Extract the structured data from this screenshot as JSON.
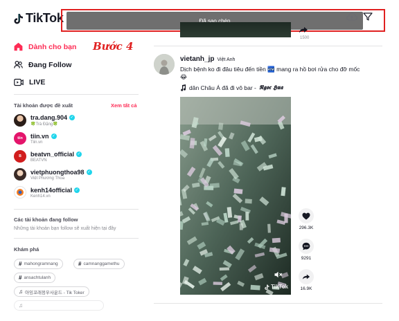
{
  "header": {
    "logo_text": "TikTok",
    "toast": "Đã sao chép"
  },
  "sidebar": {
    "nav": [
      {
        "label": "Dành cho bạn",
        "icon": "home-icon",
        "active": true
      },
      {
        "label": "Đang Follow",
        "icon": "following-icon",
        "active": false
      },
      {
        "label": "LIVE",
        "icon": "live-icon",
        "active": false
      }
    ],
    "step_label": "Bước 4",
    "suggested_title": "Tài khoản được đề xuất",
    "see_all": "Xem tất cả",
    "accounts": [
      {
        "name": "tra.dang.904",
        "sub": "🍀Trà Đặng🍀"
      },
      {
        "name": "tiin.vn",
        "sub": "Tiin.vn"
      },
      {
        "name": "beatvn_official",
        "sub": "BEATVN"
      },
      {
        "name": "vietphuongthoa98",
        "sub": "Việt Phương Thoa"
      },
      {
        "name": "kenh14official",
        "sub": "Kenh14.vn"
      }
    ],
    "following_title": "Các tài khoản đang follow",
    "following_empty": "Những tài khoản bạn follow sẽ xuất hiện tại đây",
    "discover_title": "Khám phá",
    "chips": [
      {
        "icon": "hashtag-icon",
        "label": "mahongramnang"
      },
      {
        "icon": "hashtag-icon",
        "label": "camnanggamethu"
      },
      {
        "icon": "hashtag-icon",
        "label": "ansachtulanh"
      },
      {
        "icon": "music-note-icon",
        "label": "아잉꼬래정우사운드 - Tik Toker"
      }
    ]
  },
  "feed": {
    "prev_count": "1500",
    "post": {
      "username": "vietanh_jp",
      "nickname": "Việt Anh",
      "caption": "Dịch bệnh ko đi đâu tiêu đến tiền 🏧 mang ra hồ bơi rửa cho đỡ mốc 😂",
      "music_prefix": "dân Châu Á đã đi vô bar - ",
      "music_artist": "𝕹𝖌𝖔𝖈 𝕳𝖚𝖆",
      "likes": "296.3K",
      "comments": "9291",
      "shares": "16.9K",
      "watermark": "TikTok"
    }
  },
  "colors": {
    "brand": "#fe2c55",
    "annotation_red": "#e02020",
    "toast_bg": "#6f6f6f",
    "verified": "#20d5ec"
  }
}
